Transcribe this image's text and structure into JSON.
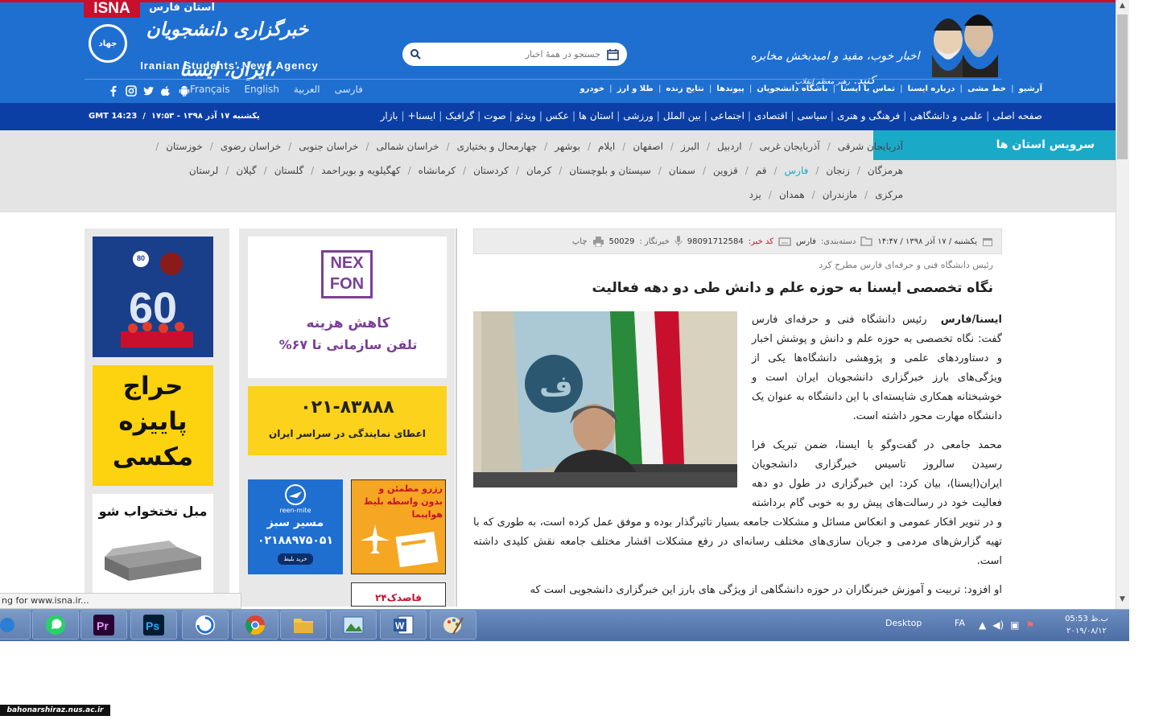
{
  "header": {
    "isna_tag": "ISNA",
    "province_tag": "استان فارس",
    "logo_fa": "خبرگزاری دانشجویان ایران، ایسنا،",
    "logo_en": "Iranian Students' News Agency",
    "emblem_text": "جهاد",
    "slogan": "اخبار خوب، مفید و امیدبخش مخابره کنید.",
    "slogan_attr": "رهبر معظم انقلاب",
    "search_placeholder": "جستجو در همهٔ اخبار",
    "languages": [
      "فارسی",
      "العربية",
      "English",
      "Français"
    ],
    "social_icons": [
      "android-icon",
      "apple-icon",
      "twitter-icon",
      "instagram-icon",
      "facebook-icon"
    ],
    "util_links": [
      "آرشیو",
      "خط مشی",
      "درباره ایسنا",
      "تماس با ایسنا",
      "باشگاه دانشجویان",
      "پیوندها",
      "نتایج زنده",
      "طلا و ارز",
      "خودرو"
    ]
  },
  "main_nav": {
    "items": [
      "صفحه اصلی",
      "علمی و دانشگاهی",
      "فرهنگی و هنری",
      "سیاسی",
      "اقتصادی",
      "اجتماعی",
      "بین الملل",
      "ورزشی",
      "استان ها",
      "عکس",
      "ویدئو",
      "صوت",
      "گرافیک",
      "ایسنا+",
      "بازار"
    ],
    "datetime": "یکشنبه ۱۷ آذر ۱۳۹۸ - ۱۷:۵۳",
    "gmt": "GMT 14:23"
  },
  "provinces": {
    "tab_label": "سرویس استان ها",
    "row1": [
      "آذربایجان شرقی",
      "آذربایجان غربی",
      "اردبیل",
      "البرز",
      "اصفهان",
      "ایلام",
      "بوشهر",
      "چهارمحال و بختیاری",
      "خراسان شمالی",
      "خراسان جنوبی",
      "خراسان رضوی",
      "خوزستان"
    ],
    "row2": [
      "هرمزگان",
      "زنجان",
      "فارس",
      "قم",
      "قزوین",
      "سمنان",
      "سیستان و بلوچستان",
      "کرمان",
      "کردستان",
      "کرمانشاه",
      "کهگیلویه و بویراحمد",
      "گلستان",
      "گیلان",
      "لرستان"
    ],
    "row3": [
      "مرکزی",
      "مازندران",
      "همدان",
      "یزد"
    ],
    "active": "فارس"
  },
  "article": {
    "date": "یکشنبه / ۱۷ آذر ۱۳۹۸ / ۱۴:۴۷",
    "category_label": "دسته‌بندی:",
    "category": "فارس",
    "news_code_label": "کد خبر:",
    "news_code": "98091712584",
    "reporter_label": "خبرنگار :",
    "reporter": "50029",
    "print_label": "چاپ",
    "lead": "رئیس دانشگاه فنی و حرفه‌ای فارس مطرح کرد",
    "headline": "نگاه تخصصی ایسنا به حوزه علم و دانش طی دو دهه فعالیت",
    "p1_source": "ایسنا/فارس",
    "p1": "رئیس دانشگاه فنی و حرفه‌ای فارس گفت: نگاه تخصصی به حوزه علم و دانش و پوشش اخبار و دستاوردهای علمی و پژوهشی دانشگاه‌ها یکی از ویژگی‌های بارز خبرگزاری دانشجویان ایران است و خوشبختانه همکاری شایسته‌ای با این دانشگاه به عنوان یک دانشگاه مهارت محور داشته است.",
    "p2": "محمد جامعی در گفت‌وگو با ایسنا، ضمن تبریک فرا رسیدن سالروز تاسیس خبرگزاری دانشجویان ایران(ایسنا)، بیان کرد: این خبرگزاری در طول دو دهه فعالیت خود در رسالت‌های پیش رو به خوبی گام برداشته و در تنویر افکار عمومی و انعکاس مسائل و مشکلات جامعه بسیار تاثیرگذار بوده و موفق عمل کرده است، به طوری که با تهیه گزارش‌های مردمی و جریان سازی‌های مختلف رسانه‌ای در رفع مشکلات اقشار مختلف جامعه نقش کلیدی داشته است.",
    "p3": "او افزود: تربیت و آموزش خبرنگاران در حوزه دانشگاهی از ویژگی های بارز این خبرگزاری دانشجویی است که"
  },
  "ads": {
    "nexfon_logo_1": "NEX",
    "nexfon_logo_2": "FON",
    "nexfon_line1": "کاهش هزینه",
    "nexfon_line2": "تلفن سازمانی تا ۶۷%",
    "phone_number": "۰۲۱-۸۳۸۸۸",
    "phone_text": "اعطای نمایندگی در سراسر ایران",
    "reen_brand": "reen-mite",
    "reen_title": "مسیر سبز",
    "reen_number": "۰۲۱۸۸۹۷۵۰۵۱",
    "reen_button": "خرید بلیط",
    "flight_text": "رزرو مطمئن و بدون واسطه بلیط هواپیما",
    "ghasedak": "قاصدک۲۴",
    "bank_badge": "80",
    "bank_60": "60",
    "sale_text": "حراج پاییزه مکسی",
    "sofa_text": "مبل تختخواب شو"
  },
  "browser": {
    "status_text": "ng for www.isna.ir..."
  },
  "taskbar": {
    "apps": [
      "whatsapp-icon",
      "premiere-icon",
      "photoshop-icon",
      "shield-app-icon",
      "chrome-icon",
      "file-explorer-icon",
      "photo-viewer-icon",
      "word-icon",
      "paint-icon"
    ],
    "desktop_label": "Desktop",
    "lang": "FA",
    "time": "ب.ظ 05:53",
    "date": "۲۰۱۹/۰۸/۱۲"
  },
  "watermark": "bahonarshiraz.nus.ac.ir",
  "colors": {
    "header_blue": "#1f6fd1",
    "nav_dark": "#0c3fa5",
    "accent_red": "#c8102e",
    "teal": "#1ba9c8"
  }
}
